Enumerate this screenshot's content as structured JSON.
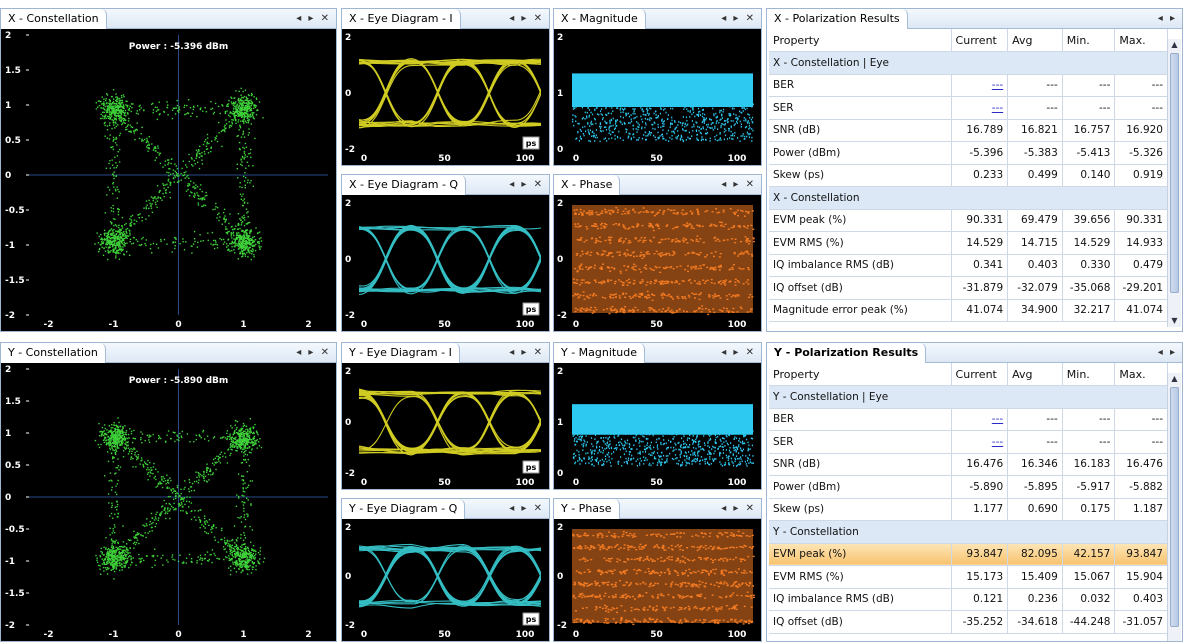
{
  "panes": {
    "x_const": {
      "title": "X - Constellation",
      "power": "Power : -5.396 dBm",
      "yticks": [
        "2",
        "1.5",
        "1",
        "0.5",
        "0",
        "-0.5",
        "-1",
        "-1.5",
        "-2"
      ],
      "xticks": [
        "-2",
        "-1",
        "0",
        "1",
        "2"
      ]
    },
    "y_const": {
      "title": "Y - Constellation",
      "power": "Power : -5.890 dBm",
      "yticks": [
        "2",
        "1.5",
        "1",
        "0.5",
        "0",
        "-0.5",
        "-1",
        "-1.5",
        "-2"
      ],
      "xticks": [
        "-2",
        "-1",
        "0",
        "1",
        "2"
      ]
    },
    "x_eye_i": {
      "title": "X - Eye Diagram - I"
    },
    "x_eye_q": {
      "title": "X - Eye Diagram - Q"
    },
    "y_eye_i": {
      "title": "Y - Eye Diagram - I"
    },
    "y_eye_q": {
      "title": "Y - Eye Diagram - Q"
    },
    "x_mag": {
      "title": "X - Magnitude"
    },
    "x_phase": {
      "title": "X - Phase"
    },
    "y_mag": {
      "title": "Y - Magnitude"
    },
    "y_phase": {
      "title": "Y - Phase"
    },
    "eye_ticks": {
      "y": [
        "2",
        "0",
        "-2"
      ],
      "x": [
        "0",
        "50",
        "100"
      ],
      "unit": "ps"
    },
    "mag_ticks": {
      "y": [
        "2",
        "1",
        "0"
      ],
      "x": [
        "0",
        "50",
        "100"
      ]
    },
    "phase_ticks": {
      "y": [
        "2",
        "0",
        "-2"
      ],
      "x": [
        "0",
        "50",
        "100"
      ]
    },
    "controls": "◂ ▸ ✕"
  },
  "x_results": {
    "title": "X - Polarization Results",
    "columns": [
      "Property",
      "Current",
      "Avg",
      "Min.",
      "Max."
    ],
    "rows": [
      {
        "type": "section",
        "label": "X - Constellation | Eye"
      },
      {
        "label": "BER",
        "current": "---",
        "avg": "---",
        "min": "---",
        "max": "---",
        "link": true
      },
      {
        "label": "SER",
        "current": "---",
        "avg": "---",
        "min": "---",
        "max": "---",
        "link": true
      },
      {
        "label": "SNR (dB)",
        "current": "16.789",
        "avg": "16.821",
        "min": "16.757",
        "max": "16.920"
      },
      {
        "label": "Power (dBm)",
        "current": "-5.396",
        "avg": "-5.383",
        "min": "-5.413",
        "max": "-5.326"
      },
      {
        "label": "Skew (ps)",
        "current": "0.233",
        "avg": "0.499",
        "min": "0.140",
        "max": "0.919"
      },
      {
        "type": "section",
        "label": "X - Constellation"
      },
      {
        "label": "EVM peak (%)",
        "current": "90.331",
        "avg": "69.479",
        "min": "39.656",
        "max": "90.331"
      },
      {
        "label": "EVM RMS (%)",
        "current": "14.529",
        "avg": "14.715",
        "min": "14.529",
        "max": "14.933"
      },
      {
        "label": "IQ imbalance RMS (dB)",
        "current": "0.341",
        "avg": "0.403",
        "min": "0.330",
        "max": "0.479"
      },
      {
        "label": "IQ offset (dB)",
        "current": "-31.879",
        "avg": "-32.079",
        "min": "-35.068",
        "max": "-29.201"
      },
      {
        "label": "Magnitude error peak (%)",
        "current": "41.074",
        "avg": "34.900",
        "min": "32.217",
        "max": "41.074"
      }
    ]
  },
  "y_results": {
    "title": "Y - Polarization Results",
    "columns": [
      "Property",
      "Current",
      "Avg",
      "Min.",
      "Max."
    ],
    "rows": [
      {
        "type": "section",
        "label": "Y - Constellation | Eye"
      },
      {
        "label": "BER",
        "current": "---",
        "avg": "---",
        "min": "---",
        "max": "---",
        "link": true
      },
      {
        "label": "SER",
        "current": "---",
        "avg": "---",
        "min": "---",
        "max": "---",
        "link": true
      },
      {
        "label": "SNR (dB)",
        "current": "16.476",
        "avg": "16.346",
        "min": "16.183",
        "max": "16.476"
      },
      {
        "label": "Power (dBm)",
        "current": "-5.890",
        "avg": "-5.895",
        "min": "-5.917",
        "max": "-5.882"
      },
      {
        "label": "Skew (ps)",
        "current": "1.177",
        "avg": "0.690",
        "min": "0.175",
        "max": "1.187"
      },
      {
        "type": "section",
        "label": "Y - Constellation"
      },
      {
        "label": "EVM peak (%)",
        "current": "93.847",
        "avg": "82.095",
        "min": "42.157",
        "max": "93.847",
        "highlight": true
      },
      {
        "label": "EVM RMS (%)",
        "current": "15.173",
        "avg": "15.409",
        "min": "15.067",
        "max": "15.904"
      },
      {
        "label": "IQ imbalance RMS (dB)",
        "current": "0.121",
        "avg": "0.236",
        "min": "0.032",
        "max": "0.403"
      },
      {
        "label": "IQ offset (dB)",
        "current": "-35.252",
        "avg": "-34.618",
        "min": "-44.248",
        "max": "-31.057"
      }
    ]
  },
  "colors": {
    "constellation": "#3fd23a",
    "eye_i": "#f6f02a",
    "eye_q": "#3ee0e6",
    "magnitude": "#2ec9f0",
    "phase": "#f27a22",
    "axis": "#2a4a8a"
  }
}
